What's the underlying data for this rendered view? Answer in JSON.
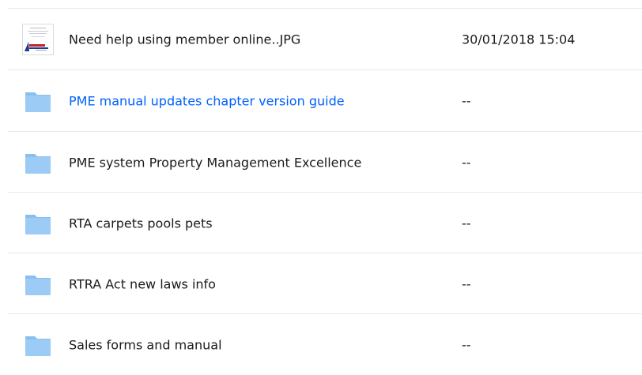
{
  "files": [
    {
      "name": "Need help using member online..JPG",
      "modified": "30/01/2018 15:04",
      "icon": "image-thumbnail-icon",
      "type": "file"
    },
    {
      "name": "PME manual updates chapter version guide",
      "modified": "--",
      "icon": "folder-icon",
      "type": "folder",
      "highlighted": true
    },
    {
      "name": "PME system Property Management Excellence",
      "modified": "--",
      "icon": "folder-icon",
      "type": "folder"
    },
    {
      "name": "RTA carpets pools pets",
      "modified": "--",
      "icon": "folder-icon",
      "type": "folder"
    },
    {
      "name": "RTRA Act new laws info",
      "modified": "--",
      "icon": "folder-icon",
      "type": "folder"
    },
    {
      "name": "Sales forms and manual",
      "modified": "--",
      "icon": "folder-icon",
      "type": "folder"
    }
  ],
  "colors": {
    "folder": "#9ccbf6",
    "folder_tab": "#89bff0",
    "link": "#0061fe",
    "text": "#1e1919",
    "divider": "#e6e8eb"
  }
}
